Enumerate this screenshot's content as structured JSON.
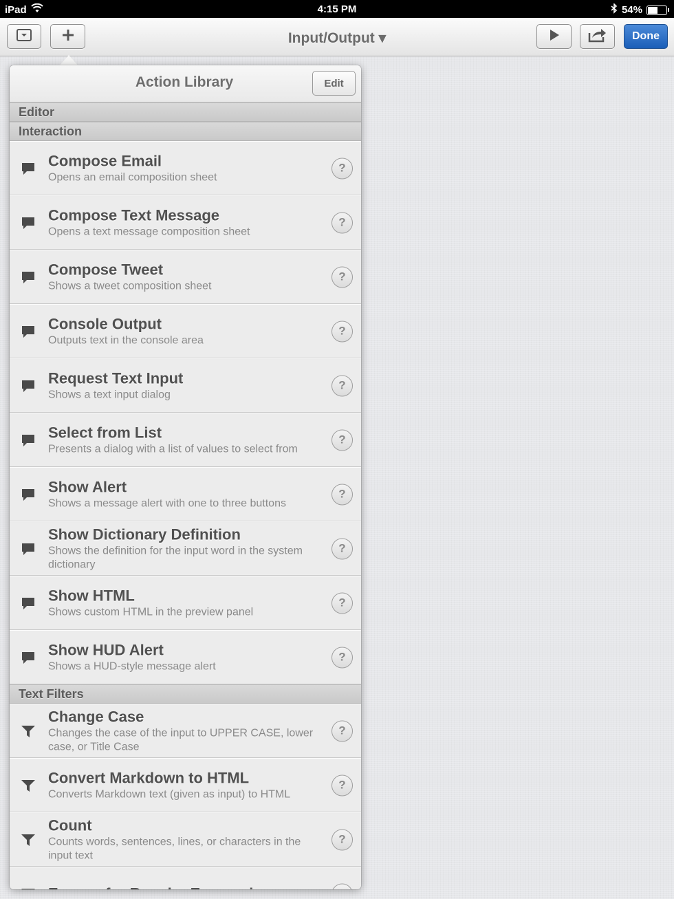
{
  "status_bar": {
    "device": "iPad",
    "time": "4:15 PM",
    "battery": "54%",
    "battery_level": 0.54
  },
  "toolbar": {
    "title": "Input/Output ▾",
    "done_label": "Done"
  },
  "popover": {
    "title": "Action Library",
    "edit_label": "Edit",
    "sections": [
      {
        "label": "Editor",
        "items": []
      },
      {
        "label": "Interaction",
        "icon": "speech-bubble-icon",
        "items": [
          {
            "title": "Compose Email",
            "desc": "Opens an email composition sheet"
          },
          {
            "title": "Compose Text Message",
            "desc": "Opens a text message composition sheet"
          },
          {
            "title": "Compose Tweet",
            "desc": "Shows a tweet composition sheet"
          },
          {
            "title": "Console Output",
            "desc": "Outputs text in the console area"
          },
          {
            "title": "Request Text Input",
            "desc": "Shows a text input dialog"
          },
          {
            "title": "Select from List",
            "desc": "Presents a dialog with a list of values to select from"
          },
          {
            "title": "Show Alert",
            "desc": "Shows a message alert with one to three buttons"
          },
          {
            "title": "Show Dictionary Definition",
            "desc": "Shows the definition for the input word in the system dictionary"
          },
          {
            "title": "Show HTML",
            "desc": "Shows custom HTML in the preview panel"
          },
          {
            "title": "Show HUD Alert",
            "desc": "Shows a HUD-style message alert"
          }
        ]
      },
      {
        "label": "Text Filters",
        "icon": "funnel-icon",
        "items": [
          {
            "title": "Change Case",
            "desc": "Changes the case of the input to UPPER CASE, lower case, or Title Case"
          },
          {
            "title": "Convert Markdown to HTML",
            "desc": "Converts Markdown text (given as input) to HTML"
          },
          {
            "title": "Count",
            "desc": "Counts words, sentences, lines, or characters in the input text"
          },
          {
            "title": "Escape for Regular Expression",
            "desc": ""
          }
        ]
      }
    ],
    "help_glyph": "?"
  }
}
